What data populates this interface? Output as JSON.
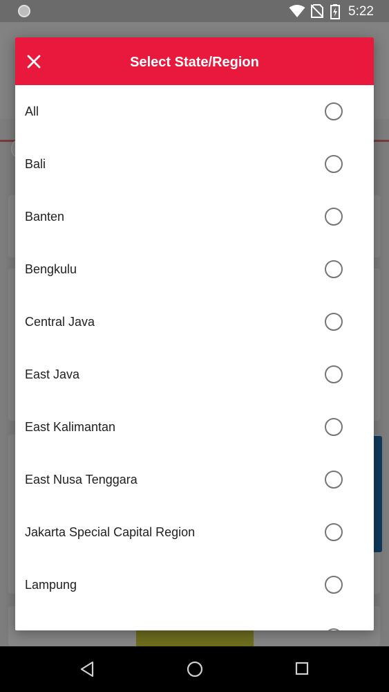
{
  "status_bar": {
    "time": "5:22",
    "icons": [
      "notification-dot-icon",
      "wifi-icon",
      "no-sim-icon",
      "battery-charging-icon"
    ]
  },
  "dialog": {
    "title": "Select State/Region",
    "close_icon": "close-icon",
    "options": [
      {
        "label": "All",
        "selected": false
      },
      {
        "label": "Bali",
        "selected": false
      },
      {
        "label": "Banten",
        "selected": false
      },
      {
        "label": "Bengkulu",
        "selected": false
      },
      {
        "label": "Central Java",
        "selected": false
      },
      {
        "label": "East Java",
        "selected": false
      },
      {
        "label": "East Kalimantan",
        "selected": false
      },
      {
        "label": "East Nusa Tenggara",
        "selected": false
      },
      {
        "label": "Jakarta Special Capital Region",
        "selected": false
      },
      {
        "label": "Lampung",
        "selected": false
      }
    ]
  },
  "nav_bar": {
    "icons": [
      "back-icon",
      "home-icon",
      "recents-icon"
    ]
  },
  "colors": {
    "accent": "#e8193c",
    "text": "#212121",
    "radio": "#757575"
  }
}
